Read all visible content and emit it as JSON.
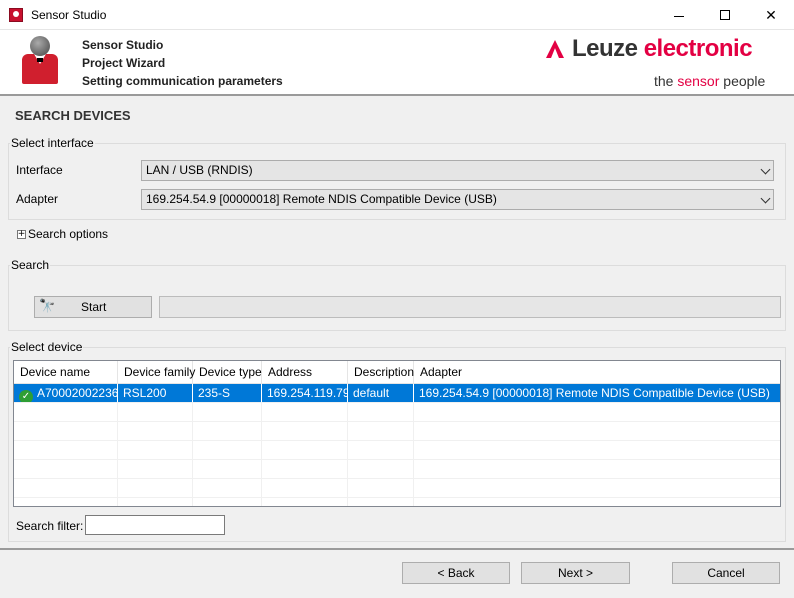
{
  "window": {
    "title": "Sensor Studio",
    "minimize": "",
    "maximize": "",
    "close": "✕"
  },
  "header": {
    "line1": "Sensor Studio",
    "line2": "Project Wizard",
    "line3": "Setting communication parameters",
    "brand_leuze": "Leuze",
    "brand_electronic": "electronic",
    "tagline_start": "the ",
    "tagline_accent": "sensor",
    "tagline_end": " people"
  },
  "page": {
    "section_title": "SEARCH DEVICES"
  },
  "select_interface": {
    "group_label": "Select interface",
    "interface_label": "Interface",
    "interface_value": "LAN / USB (RNDIS)",
    "adapter_label": "Adapter",
    "adapter_value": "169.254.54.9 [00000018] Remote NDIS Compatible Device (USB)"
  },
  "search_options": {
    "expander_symbol": "+",
    "label": "Search options"
  },
  "search": {
    "group_label": "Search",
    "start_label": "Start",
    "progress_percent": 0
  },
  "select_device": {
    "group_label": "Select device",
    "columns": [
      "Device name",
      "Device family",
      "Device type",
      "Address",
      "Description",
      "Adapter"
    ],
    "rows": [
      {
        "status_icon": "✓",
        "device_name": "A70002002236",
        "device_family": "RSL200",
        "device_type": "235-S",
        "address": "169.254.119.79",
        "description": "default",
        "adapter": "169.254.54.9 [00000018] Remote NDIS Compatible Device (USB)",
        "selected": true
      }
    ],
    "empty_row_count": 6,
    "filter_label": "Search filter:",
    "filter_value": ""
  },
  "footer": {
    "back_label": "< Back",
    "next_label": "Next >",
    "cancel_label": "Cancel"
  },
  "colors": {
    "brand_red": "#e30043",
    "selection_blue": "#0078d7",
    "status_green": "#2e9e35"
  },
  "icons": {
    "app": "sensor-studio-app-icon",
    "wizard": "wizard-avatar-icon",
    "search": "binoculars-icon",
    "status": "checkmark-circle-icon"
  }
}
